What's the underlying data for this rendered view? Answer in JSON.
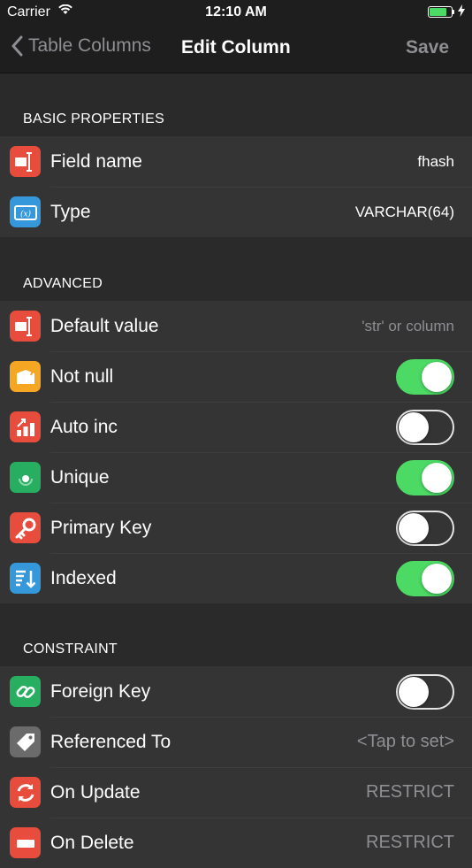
{
  "status_bar": {
    "carrier": "Carrier",
    "time": "12:10 AM",
    "battery_level": 0.8
  },
  "nav": {
    "back_label": "Table Columns",
    "title": "Edit Column",
    "save_label": "Save"
  },
  "sections": {
    "basic": {
      "header": "BASIC PROPERTIES",
      "rows": [
        {
          "label": "Field name",
          "value": "fhash",
          "icon": "field-name-icon",
          "color": "#e74c3c"
        },
        {
          "label": "Type",
          "value": "VARCHAR(64)",
          "icon": "type-variable-icon",
          "color": "#3498db"
        }
      ]
    },
    "advanced": {
      "header": "ADVANCED",
      "rows": [
        {
          "label": "Default value",
          "placeholder": "'str' or column",
          "icon": "default-value-icon",
          "color": "#e74c3c"
        },
        {
          "label": "Not null",
          "on": true,
          "icon": "box-icon",
          "color": "#f5a623"
        },
        {
          "label": "Auto inc",
          "on": false,
          "icon": "bar-chart-icon",
          "color": "#e74c3c"
        },
        {
          "label": "Unique",
          "on": true,
          "icon": "unique-dot-icon",
          "color": "#27ae60"
        },
        {
          "label": "Primary Key",
          "on": false,
          "icon": "key-icon",
          "color": "#e74c3c"
        },
        {
          "label": "Indexed",
          "on": true,
          "icon": "sort-icon",
          "color": "#3498db"
        }
      ]
    },
    "constraint": {
      "header": "CONSTRAINT",
      "rows": [
        {
          "label": "Foreign Key",
          "on": false,
          "icon": "link-icon",
          "color": "#27ae60"
        },
        {
          "label": "Referenced To",
          "placeholder": "<Tap to set>",
          "icon": "tag-icon",
          "color": "#6b6b6b"
        },
        {
          "label": "On Update",
          "value": "RESTRICT",
          "icon": "refresh-icon",
          "color": "#e74c3c"
        },
        {
          "label": "On Delete",
          "value": "RESTRICT",
          "icon": "delete-icon",
          "color": "#e74c3c"
        }
      ]
    }
  }
}
